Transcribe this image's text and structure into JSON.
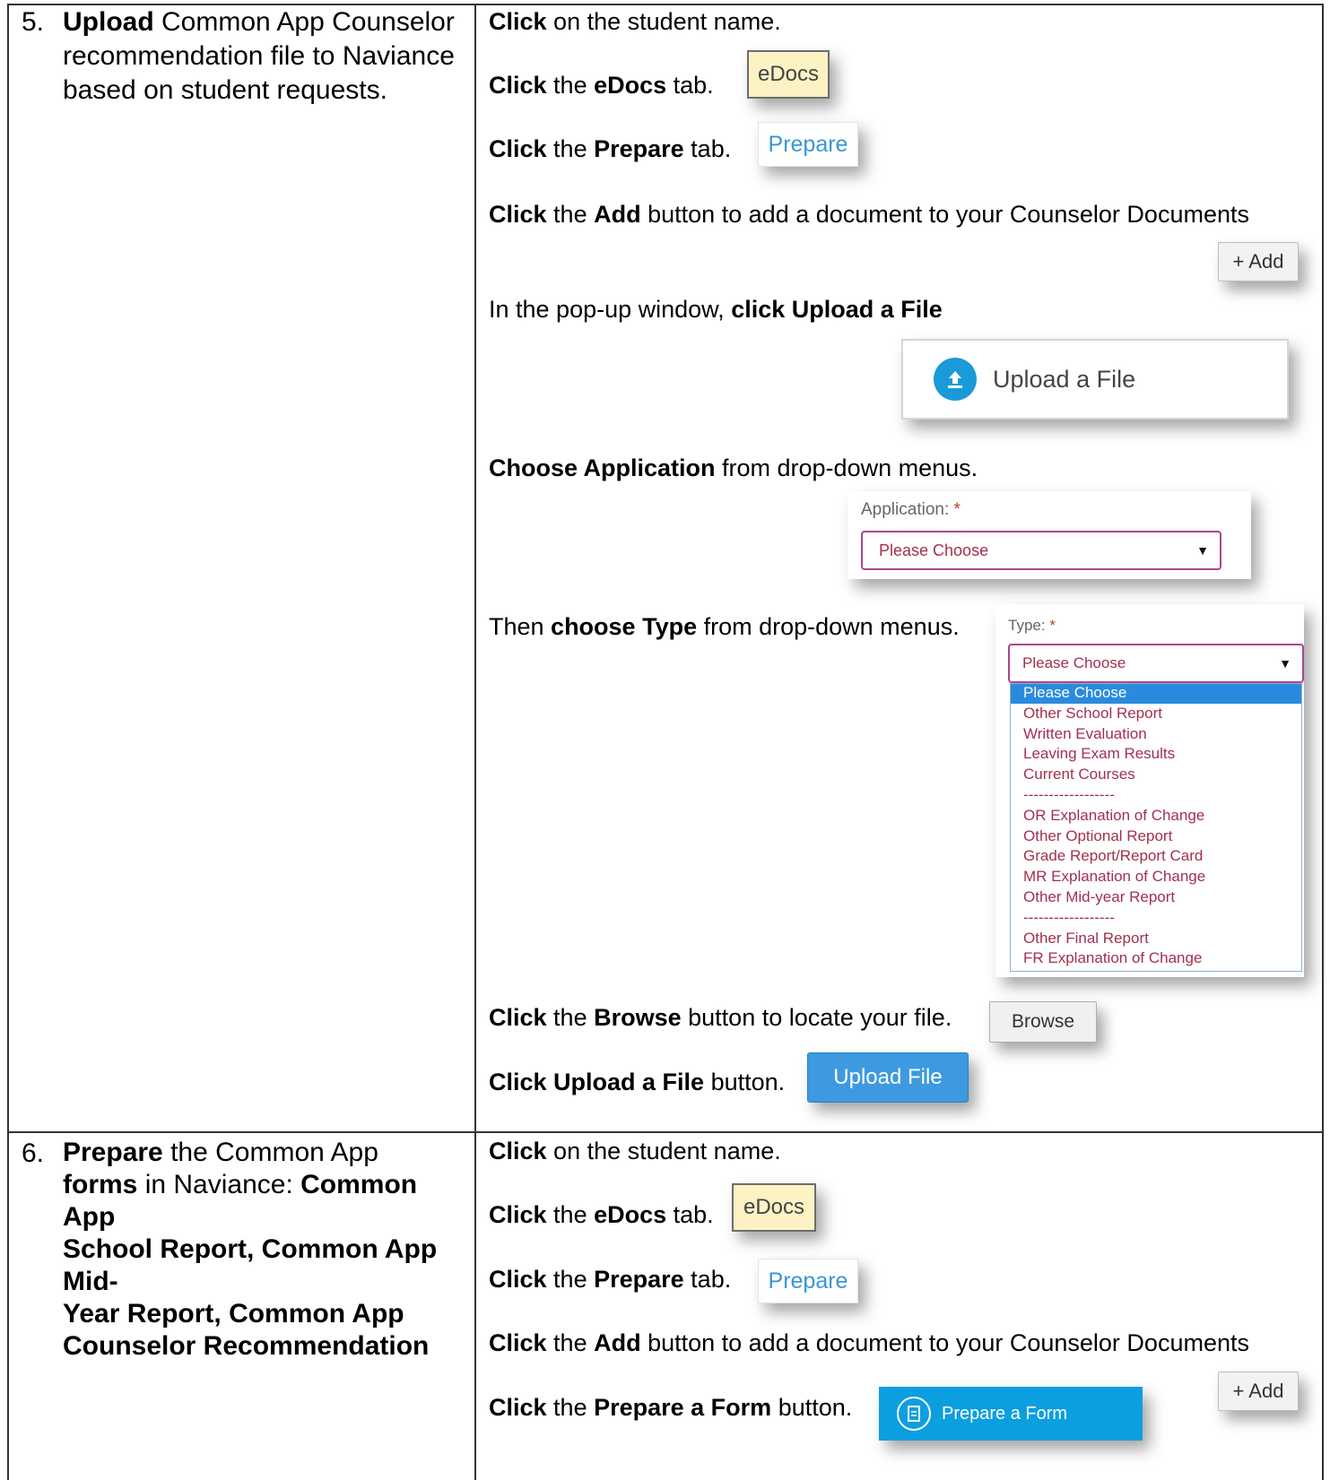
{
  "row5": {
    "number": "5.",
    "left": {
      "bold1": "Upload",
      "rest1": " Common App Counselor",
      "line2": "recommendation file to Naviance",
      "line3": "based on student requests."
    },
    "steps": {
      "s1": {
        "b": "Click",
        "t": " on the student name."
      },
      "s2": {
        "b1": "Click",
        "t1": " the ",
        "b2": "eDocs",
        "t2": " tab."
      },
      "s3": {
        "b1": "Click",
        "t1": " the ",
        "b2": "Prepare",
        "t2": " tab."
      },
      "s4": {
        "b1": "Click",
        "t1": " the ",
        "b2": "Add",
        "t2": " button to add a document to your Counselor Documents"
      },
      "s5": {
        "t1": "In the pop-up window, ",
        "b1": "click Upload a File"
      },
      "s6": {
        "b1": "Choose Application",
        "t1": " from drop-down menus."
      },
      "s7": {
        "t1": "Then ",
        "b1": "choose Type",
        "t1b": " from drop-down menus."
      },
      "s8": {
        "b1": "Click",
        "t1": " the ",
        "b2": "Browse",
        "t2": " button to locate your file."
      },
      "s9": {
        "b1": "Click Upload a File",
        "t1": " button."
      }
    },
    "ui": {
      "edocs": "eDocs",
      "prepare": "Prepare",
      "add": "+ Add",
      "upload_a_file": "Upload a File",
      "application_label": "Application:",
      "required": "*",
      "please_choose": "Please Choose",
      "type_label": "Type:",
      "type_options": [
        "Please Choose",
        "Other School Report",
        "Written Evaluation",
        "Leaving Exam Results",
        "Current Courses",
        "------------------",
        "OR Explanation of Change",
        "Other Optional Report",
        "Grade Report/Report Card",
        "MR Explanation of Change",
        "Other Mid-year Report",
        "------------------",
        "Other Final Report",
        "FR Explanation of Change"
      ],
      "browse": "Browse",
      "upload_file": "Upload File"
    }
  },
  "row6": {
    "number": "6.",
    "left": {
      "l1b": "Prepare",
      "l1t": " the Common App",
      "l2b": "forms",
      "l2t": " in Naviance:  ",
      "l2b2": "Common App",
      "l3": "School Report, Common App Mid-",
      "l4": "Year Report, Common App",
      "l5": "Counselor Recommendation"
    },
    "steps": {
      "s1": {
        "b": "Click",
        "t": " on the student name."
      },
      "s2": {
        "b1": "Click",
        "t1": " the ",
        "b2": "eDocs",
        "t2": " tab."
      },
      "s3": {
        "b1": "Click",
        "t1": " the ",
        "b2": "Prepare",
        "t2": " tab."
      },
      "s4": {
        "b1": "Click",
        "t1": " the ",
        "b2": "Add",
        "t2": " button to add a document to your Counselor  Documents"
      },
      "s5": {
        "b1": "Click",
        "t1": " the ",
        "b2": "Prepare a Form",
        "t2": " button."
      }
    },
    "ui": {
      "edocs": "eDocs",
      "prepare": "Prepare",
      "add": "+ Add",
      "prepare_form": "Prepare a Form"
    }
  }
}
